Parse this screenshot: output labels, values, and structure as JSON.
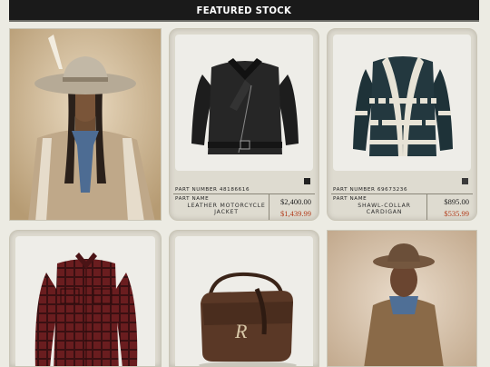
{
  "header": {
    "title": "FEATURED STOCK"
  },
  "products": [
    {
      "part_number": "PART NUMBER 48186616",
      "name_label": "PART NAME",
      "name": "LEATHER MOTORCYCLE JACKET",
      "price": "$2,400.00",
      "sale_price": "$1,439.99"
    },
    {
      "part_number": "PART NUMBER 69673236",
      "name_label": "PART NAME",
      "name": "SHAWL-COLLAR CARDIGAN",
      "price": "$895.00",
      "sale_price": "$535.99"
    }
  ],
  "colors": {
    "header_bg": "#1a1a1a",
    "sale_red": "#b23b1a",
    "page_bg": "#ecebe3"
  }
}
